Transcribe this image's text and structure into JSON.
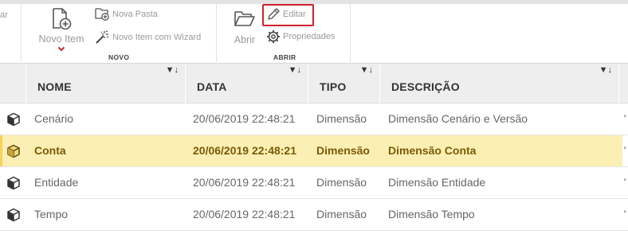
{
  "ribbon": {
    "left_cut_text": "ar",
    "novo": {
      "novo_item_label": "Novo Item",
      "nova_pasta_label": "Nova Pasta",
      "novo_item_wizard_label": "Novo Item com Wizard",
      "group_label": "NOVO"
    },
    "abrir": {
      "abrir_label": "Abrir",
      "editar_label": "Editar",
      "propriedades_label": "Propriedades",
      "group_label": "ABRIR"
    },
    "highlight_color": "#d0202a"
  },
  "grid": {
    "columns": [
      {
        "label": "NOME",
        "filter_icon": "filter-sort-icon"
      },
      {
        "label": "DATA",
        "filter_icon": "filter-sort-icon"
      },
      {
        "label": "TIPO",
        "filter_icon": "filter-sort-icon"
      },
      {
        "label": "DESCRIÇÃO",
        "filter_icon": "filter-sort-icon"
      }
    ],
    "filter_glyph": "▼↓",
    "rows": [
      {
        "icon": "cube-icon",
        "nome": "Cenário",
        "data": "20/06/2019 22:48:21",
        "tipo": "Dimensão",
        "descricao": "Dimensão Cenário e Versão",
        "selected": false
      },
      {
        "icon": "cube-icon",
        "nome": "Conta",
        "data": "20/06/2019 22:48:21",
        "tipo": "Dimensão",
        "descricao": "Dimensão Conta",
        "selected": true
      },
      {
        "icon": "cube-icon",
        "nome": "Entidade",
        "data": "20/06/2019 22:48:21",
        "tipo": "Dimensão",
        "descricao": "Dimensão Entidade",
        "selected": false
      },
      {
        "icon": "cube-icon",
        "nome": "Tempo",
        "data": "20/06/2019 22:48:21",
        "tipo": "Dimensão",
        "descricao": "Dimensão Tempo",
        "selected": false
      }
    ],
    "selected_row_color": "#fcefb4",
    "edge_glyph": "'"
  }
}
